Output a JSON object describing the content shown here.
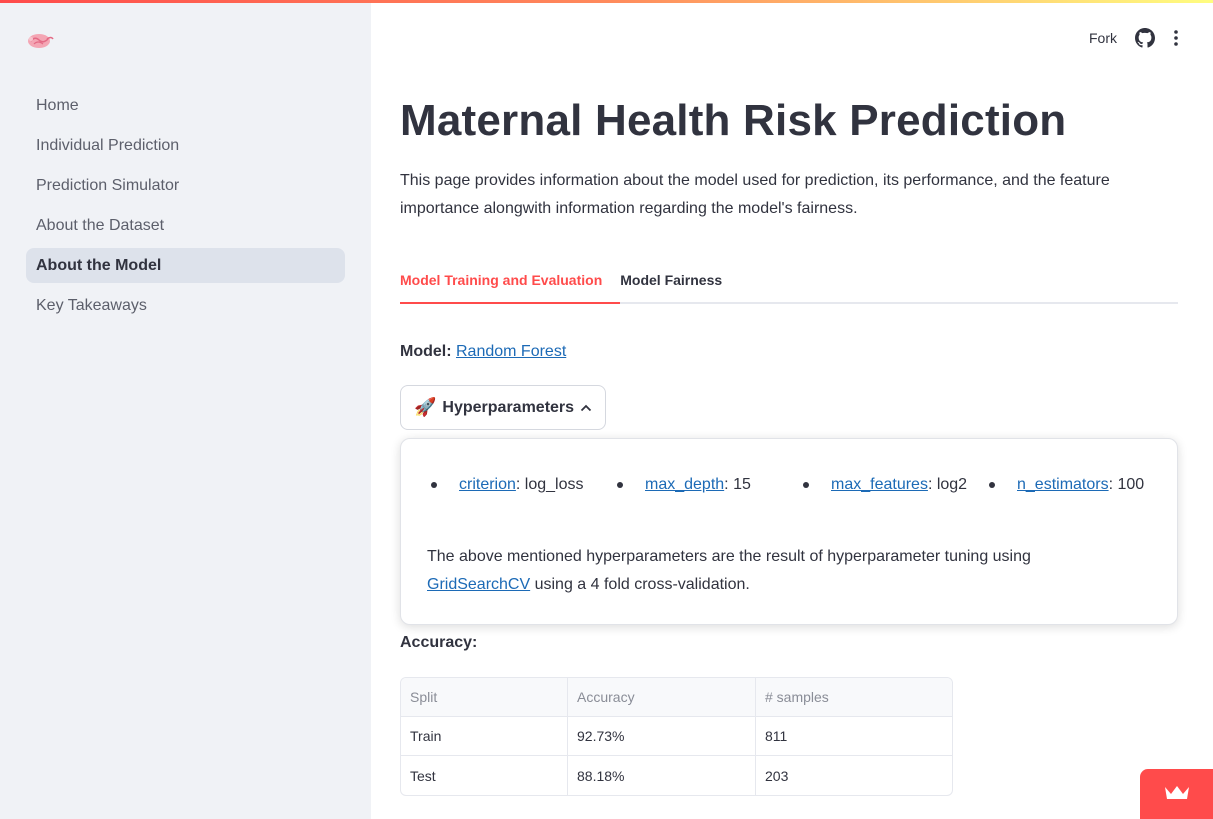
{
  "sidebar": {
    "logo_icon": "placenta-logo-icon",
    "items": [
      {
        "label": "Home",
        "active": false
      },
      {
        "label": "Individual Prediction",
        "active": false
      },
      {
        "label": "Prediction Simulator",
        "active": false
      },
      {
        "label": "About the Dataset",
        "active": false
      },
      {
        "label": "About the Model",
        "active": true
      },
      {
        "label": "Key Takeaways",
        "active": false
      }
    ]
  },
  "header": {
    "fork_label": "Fork",
    "github_icon": "github-icon",
    "menu_icon": "kebab-menu-icon"
  },
  "main": {
    "title": "Maternal Health Risk Prediction",
    "intro": "This page provides information about the model used for prediction, its performance, and the feature importance alongwith information regarding the model's fairness.",
    "tabs": [
      {
        "label": "Model Training and Evaluation",
        "active": true
      },
      {
        "label": "Model Fairness",
        "active": false
      }
    ],
    "model": {
      "label": "Model:",
      "value": "Random Forest"
    },
    "expander": {
      "icon": "rocket-icon",
      "label": "Hyperparameters",
      "expanded": true,
      "params": [
        {
          "name": "criterion",
          "value": ": log_loss"
        },
        {
          "name": "max_depth",
          "value": ": 15"
        },
        {
          "name": "max_features",
          "value": ": log2"
        },
        {
          "name": "n_estimators",
          "value": ": 100"
        }
      ],
      "note_before": "The above mentioned hyperparameters are the result of hyperparameter tuning using ",
      "note_link": "GridSearchCV",
      "note_after": " using a 4 fold cross-validation."
    },
    "accuracy": {
      "label": "Accuracy:",
      "columns": [
        "Split",
        "Accuracy",
        "# samples"
      ],
      "rows": [
        [
          "Train",
          "92.73%",
          "811"
        ],
        [
          "Test",
          "88.18%",
          "203"
        ]
      ]
    }
  },
  "badge": {
    "icon": "crown-icon"
  },
  "colors": {
    "accent": "#ff4b4b",
    "link": "#1c6ab6",
    "sidebar_bg": "#f0f2f6"
  }
}
